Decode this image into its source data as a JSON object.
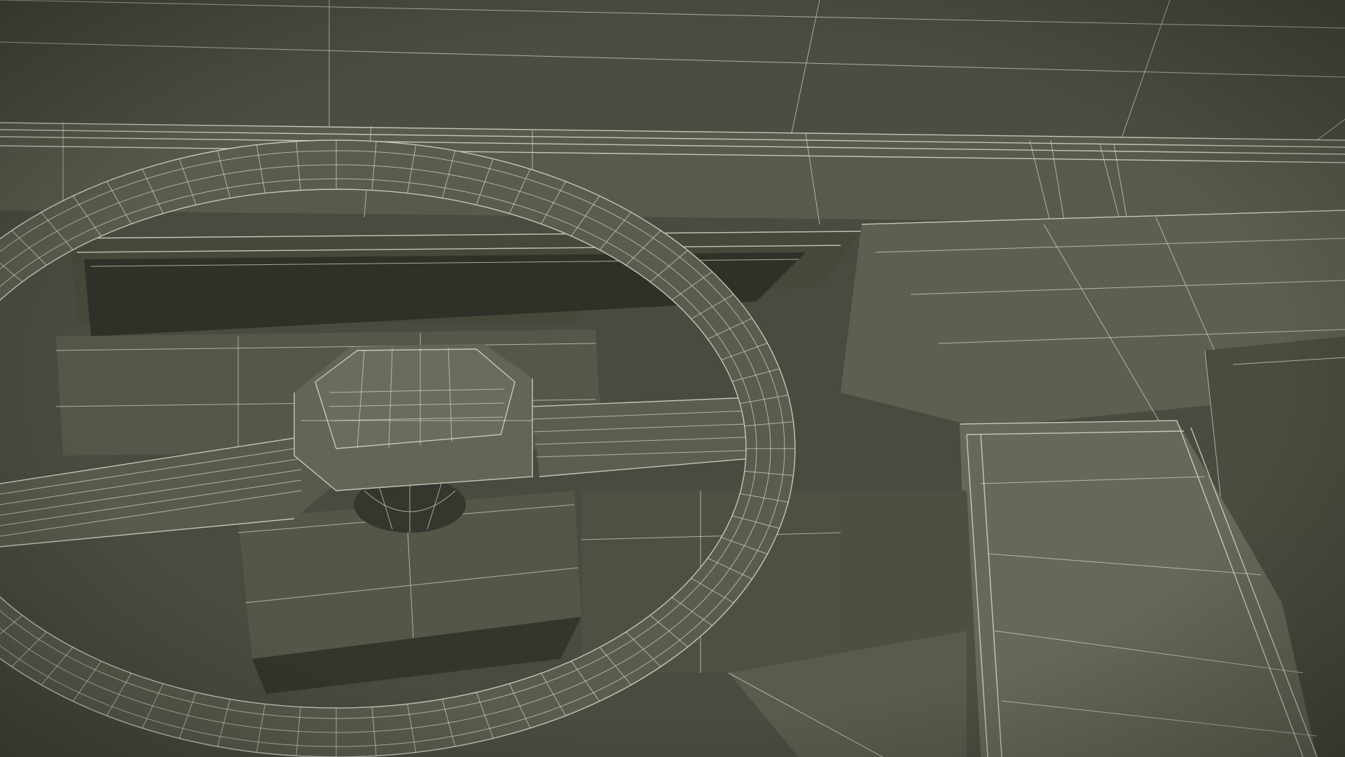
{
  "scene": {
    "subject": "steering-wheel-wireframe-render",
    "colors": {
      "background": "#4a4b40",
      "surface_dark": "#3b3c32",
      "surface_mid": "#55574a",
      "surface_light": "#676a5a",
      "shadow": "#2e2f27",
      "wire": "#d8d9cc"
    },
    "icons": {
      "wheel": "steering-wheel-icon"
    }
  }
}
